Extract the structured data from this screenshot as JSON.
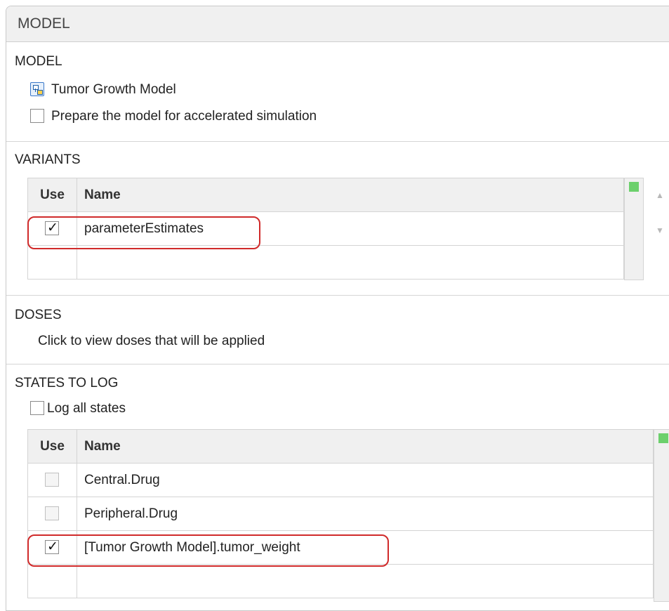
{
  "header": {
    "title": "MODEL"
  },
  "model_section": {
    "title": "MODEL",
    "model_name": "Tumor Growth Model",
    "model_icon": "simbiology-model-icon",
    "accelerate_label": "Prepare the model for accelerated simulation",
    "accelerate_checked": false
  },
  "variants_section": {
    "title": "VARIANTS",
    "columns": [
      "Use",
      "Name"
    ],
    "rows": [
      {
        "use": true,
        "name": "parameterEstimates"
      },
      {
        "use": false,
        "name": ""
      }
    ]
  },
  "doses_section": {
    "title": "DOSES",
    "hint": "Click to view doses that will be applied"
  },
  "states_section": {
    "title": "STATES TO LOG",
    "log_all_label": "Log all states",
    "log_all_checked": false,
    "columns": [
      "Use",
      "Name"
    ],
    "rows": [
      {
        "use": false,
        "name": "Central.Drug"
      },
      {
        "use": false,
        "name": "Peripheral.Drug"
      },
      {
        "use": true,
        "name": "[Tumor Growth Model].tumor_weight"
      },
      {
        "use": false,
        "name": ""
      }
    ]
  },
  "colors": {
    "highlight": "#d02a2a",
    "status_green": "#6cd06c"
  }
}
